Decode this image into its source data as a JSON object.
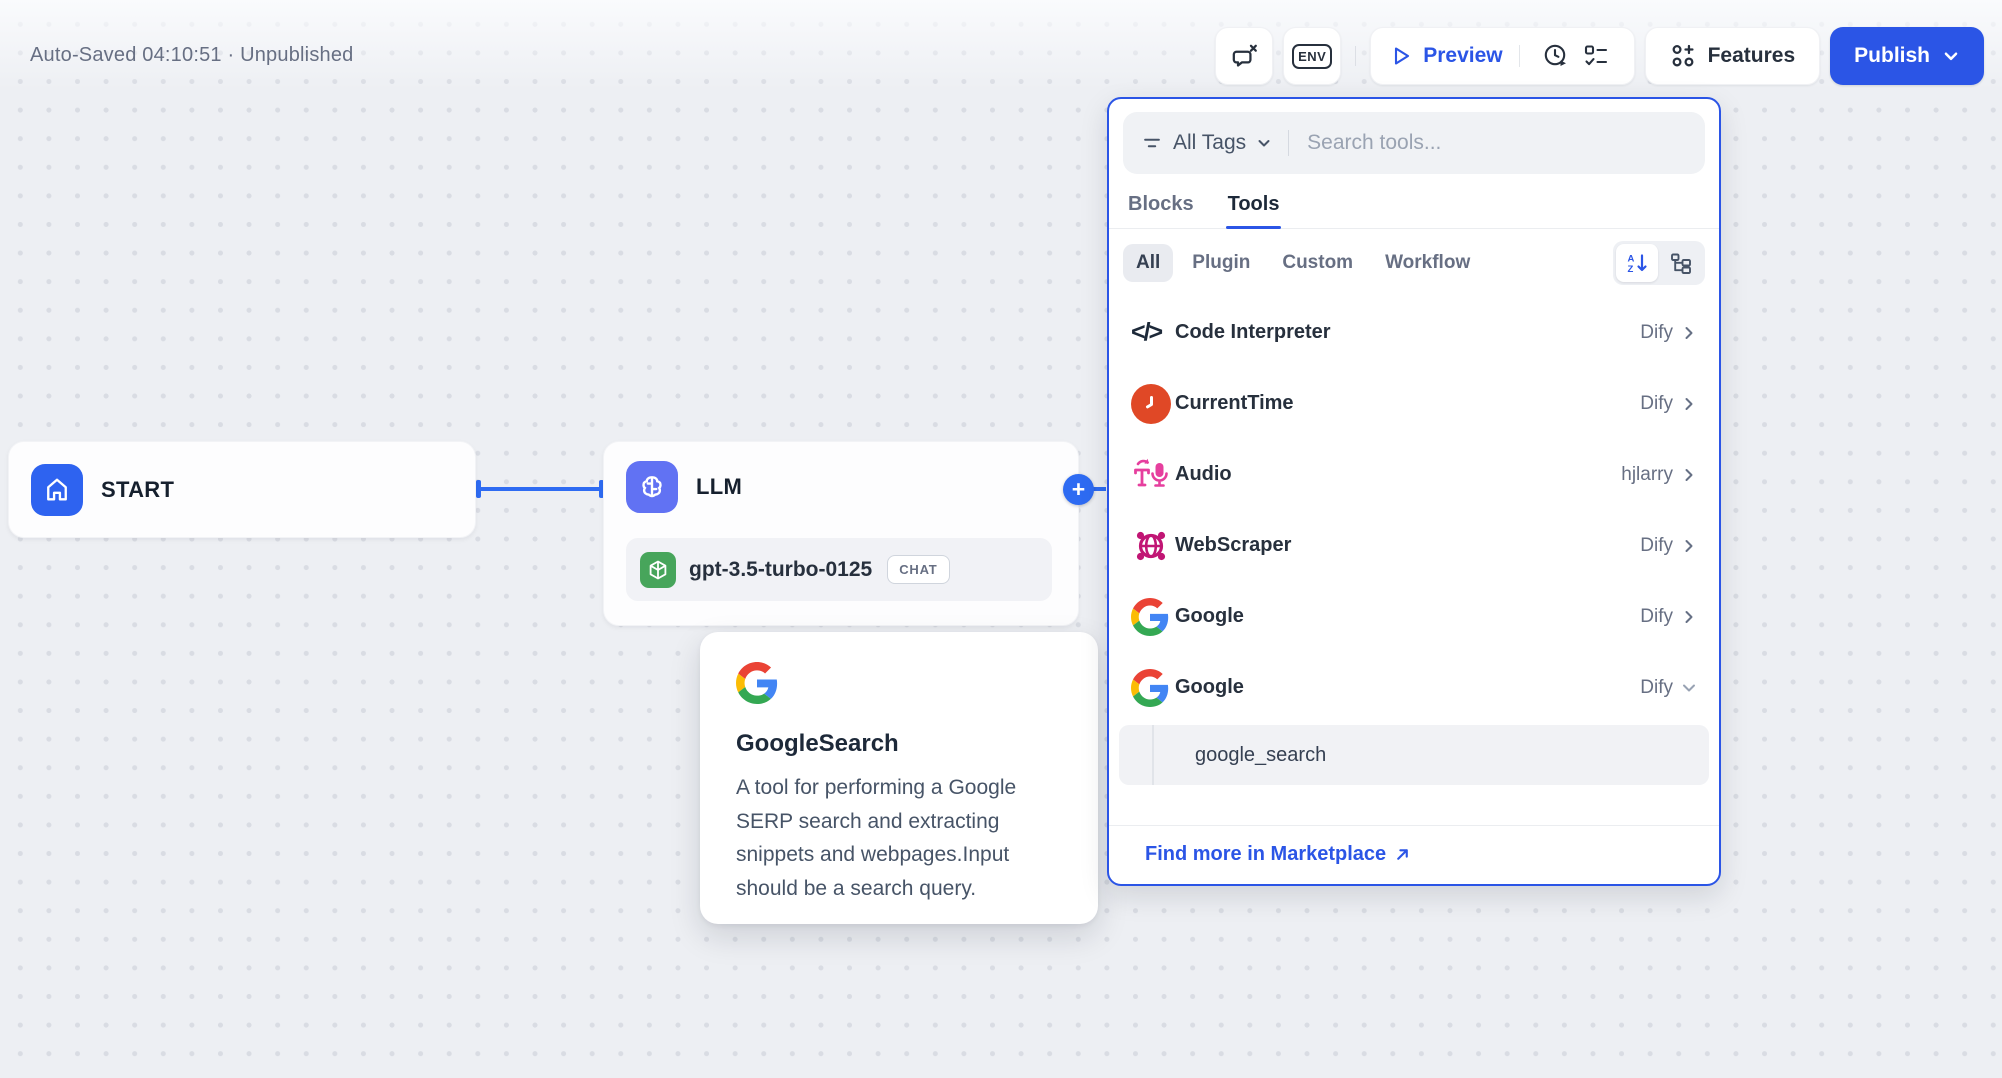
{
  "colors": {
    "accent": "#2b55e6",
    "wire_blue": "#2e6bf2",
    "llm_icon_bg": "#6172f3",
    "start_icon_bg": "#2e63f0",
    "currenttime_icon_bg": "#e04826",
    "audio_icon_pink": "#e63f9e",
    "webscraper_icon_magenta": "#c11574",
    "openai_icon_green": "#47a55b"
  },
  "header": {
    "autosave": "Auto-Saved 04:10:51 · Unpublished",
    "env_label": "ENV",
    "preview_label": "Preview",
    "features_label": "Features",
    "publish_label": "Publish"
  },
  "panel": {
    "all_tags_label": "All Tags",
    "search_placeholder": "Search tools...",
    "tabs": [
      {
        "label": "Blocks"
      },
      {
        "label": "Tools"
      }
    ],
    "filters": [
      {
        "label": "All"
      },
      {
        "label": "Plugin"
      },
      {
        "label": "Custom"
      },
      {
        "label": "Workflow"
      }
    ],
    "tools": [
      {
        "name": "Code Interpreter",
        "author": "Dify"
      },
      {
        "name": "CurrentTime",
        "author": "Dify"
      },
      {
        "name": "Audio",
        "author": "hjlarry"
      },
      {
        "name": "WebScraper",
        "author": "Dify"
      },
      {
        "name": "Google",
        "author": "Dify"
      },
      {
        "name": "Google",
        "author": "Dify"
      }
    ],
    "sub_tool": "google_search",
    "footer_link": "Find more in Marketplace"
  },
  "canvas": {
    "start_node": {
      "title": "START"
    },
    "llm_node": {
      "title": "LLM",
      "model": "gpt-3.5-turbo-0125",
      "mode_badge": "CHAT"
    },
    "tooltip": {
      "title": "GoogleSearch",
      "description": "A tool for performing a Google SERP search and extracting snippets and webpages.Input should be a search query."
    }
  }
}
